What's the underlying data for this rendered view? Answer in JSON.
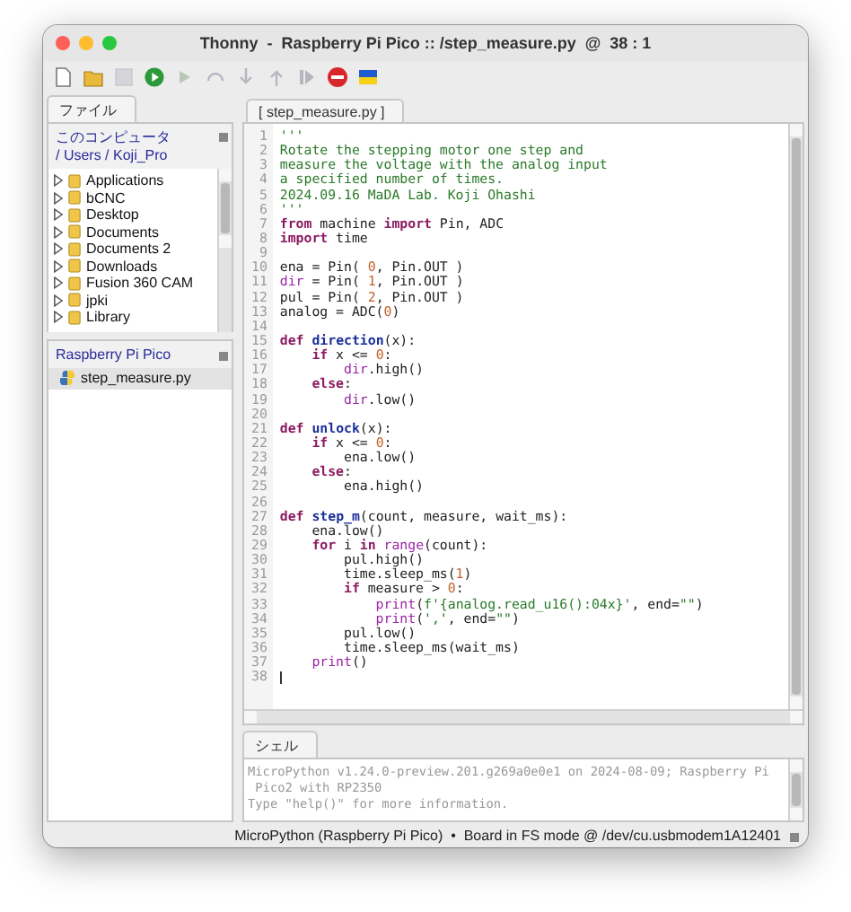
{
  "window": {
    "title": "Thonny  -  Raspberry Pi Pico :: /step_measure.py  @  38 : 1"
  },
  "toolbar": [
    {
      "kind": "new",
      "disabled": false
    },
    {
      "kind": "open",
      "disabled": false
    },
    {
      "kind": "save",
      "disabled": true
    },
    {
      "kind": "run",
      "disabled": false
    },
    {
      "kind": "debug",
      "disabled": true
    },
    {
      "kind": "step_over",
      "disabled": true
    },
    {
      "kind": "step_into",
      "disabled": true
    },
    {
      "kind": "step_out",
      "disabled": true
    },
    {
      "kind": "resume",
      "disabled": true
    },
    {
      "kind": "stop",
      "disabled": false
    },
    {
      "kind": "flag",
      "disabled": false
    }
  ],
  "files_panel": {
    "tab": "ファイル",
    "location": "このコンピュータ",
    "path": "/ Users / Koji_Pro",
    "items": [
      {
        "name": "Applications",
        "expanded": false
      },
      {
        "name": "bCNC",
        "expanded": false
      },
      {
        "name": "Desktop",
        "expanded": false
      },
      {
        "name": "Documents",
        "expanded": false
      },
      {
        "name": "Documents 2",
        "expanded": false
      },
      {
        "name": "Downloads",
        "expanded": false
      },
      {
        "name": "Fusion 360 CAM",
        "expanded": false
      },
      {
        "name": "jpki",
        "expanded": false
      },
      {
        "name": "Library",
        "expanded": false
      }
    ]
  },
  "device_panel": {
    "title": "Raspberry Pi Pico",
    "files": [
      {
        "name": "step_measure.py",
        "selected": true
      }
    ]
  },
  "editor": {
    "tab": "[ step_measure.py ]",
    "lines": [
      {
        "n": "1",
        "tokens": [
          {
            "kind": "comment",
            "text": "'''"
          }
        ]
      },
      {
        "n": "2",
        "tokens": [
          {
            "kind": "comment",
            "text": "Rotate the stepping motor one step and"
          }
        ]
      },
      {
        "n": "3",
        "tokens": [
          {
            "kind": "comment",
            "text": "measure the voltage with the analog input"
          }
        ]
      },
      {
        "n": "4",
        "tokens": [
          {
            "kind": "comment",
            "text": "a specified number of times."
          }
        ]
      },
      {
        "n": "5",
        "tokens": [
          {
            "kind": "comment",
            "text": "2024.09.16 MaDA Lab. Koji Ohashi"
          }
        ]
      },
      {
        "n": "6",
        "tokens": [
          {
            "kind": "comment",
            "text": "'''"
          }
        ]
      },
      {
        "n": "7",
        "tokens": [
          {
            "kind": "keyword",
            "text": "from"
          },
          {
            "kind": "plain",
            "text": " machine "
          },
          {
            "kind": "keyword",
            "text": "import"
          },
          {
            "kind": "plain",
            "text": " Pin, ADC"
          }
        ]
      },
      {
        "n": "8",
        "tokens": [
          {
            "kind": "keyword",
            "text": "import"
          },
          {
            "kind": "plain",
            "text": " time"
          }
        ]
      },
      {
        "n": "9"
      },
      {
        "n": "10",
        "tokens": [
          {
            "kind": "plain",
            "text": "ena = Pin( "
          },
          {
            "kind": "number",
            "text": "0"
          },
          {
            "kind": "plain",
            "text": ", Pin.OUT )"
          }
        ]
      },
      {
        "n": "11",
        "tokens": [
          {
            "kind": "builtin",
            "text": "dir"
          },
          {
            "kind": "plain",
            "text": " = Pin( "
          },
          {
            "kind": "number",
            "text": "1"
          },
          {
            "kind": "plain",
            "text": ", Pin.OUT )"
          }
        ]
      },
      {
        "n": "12",
        "tokens": [
          {
            "kind": "plain",
            "text": "pul = Pin( "
          },
          {
            "kind": "number",
            "text": "2"
          },
          {
            "kind": "plain",
            "text": ", Pin.OUT )"
          }
        ]
      },
      {
        "n": "13",
        "tokens": [
          {
            "kind": "plain",
            "text": "analog = ADC("
          },
          {
            "kind": "number",
            "text": "0"
          },
          {
            "kind": "plain",
            "text": ")"
          }
        ]
      },
      {
        "n": "14"
      },
      {
        "n": "15",
        "tokens": [
          {
            "kind": "keyword",
            "text": "def "
          },
          {
            "kind": "function",
            "text": "direction"
          },
          {
            "kind": "plain",
            "text": "(x):"
          }
        ]
      },
      {
        "n": "16",
        "tokens": [
          {
            "kind": "keyword",
            "text": "    if"
          },
          {
            "kind": "plain",
            "text": " x <= "
          },
          {
            "kind": "number",
            "text": "0"
          },
          {
            "kind": "plain",
            "text": ":"
          }
        ]
      },
      {
        "n": "17",
        "tokens": [
          {
            "kind": "builtin",
            "text": "        dir"
          },
          {
            "kind": "plain",
            "text": ".high()"
          }
        ]
      },
      {
        "n": "18",
        "tokens": [
          {
            "kind": "keyword",
            "text": "    else"
          },
          {
            "kind": "plain",
            "text": ":"
          }
        ]
      },
      {
        "n": "19",
        "tokens": [
          {
            "kind": "builtin",
            "text": "        dir"
          },
          {
            "kind": "plain",
            "text": ".low()"
          }
        ]
      },
      {
        "n": "20"
      },
      {
        "n": "21",
        "tokens": [
          {
            "kind": "keyword",
            "text": "def "
          },
          {
            "kind": "function",
            "text": "unlock"
          },
          {
            "kind": "plain",
            "text": "(x):"
          }
        ]
      },
      {
        "n": "22",
        "tokens": [
          {
            "kind": "keyword",
            "text": "    if"
          },
          {
            "kind": "plain",
            "text": " x <= "
          },
          {
            "kind": "number",
            "text": "0"
          },
          {
            "kind": "plain",
            "text": ":"
          }
        ]
      },
      {
        "n": "23",
        "tokens": [
          {
            "kind": "plain",
            "text": "        ena.low()"
          }
        ]
      },
      {
        "n": "24",
        "tokens": [
          {
            "kind": "keyword",
            "text": "    else"
          },
          {
            "kind": "plain",
            "text": ":"
          }
        ]
      },
      {
        "n": "25",
        "tokens": [
          {
            "kind": "plain",
            "text": "        ena.high()"
          }
        ]
      },
      {
        "n": "26"
      },
      {
        "n": "27",
        "tokens": [
          {
            "kind": "keyword",
            "text": "def "
          },
          {
            "kind": "function",
            "text": "step_m"
          },
          {
            "kind": "plain",
            "text": "(count, measure, wait_ms):"
          }
        ]
      },
      {
        "n": "28",
        "tokens": [
          {
            "kind": "plain",
            "text": "    ena.low()"
          }
        ]
      },
      {
        "n": "29",
        "tokens": [
          {
            "kind": "keyword",
            "text": "    for"
          },
          {
            "kind": "plain",
            "text": " i "
          },
          {
            "kind": "keyword",
            "text": "in"
          },
          {
            "kind": "builtin",
            "text": " range"
          },
          {
            "kind": "plain",
            "text": "(count):"
          }
        ]
      },
      {
        "n": "30",
        "tokens": [
          {
            "kind": "plain",
            "text": "        pul.high()"
          }
        ]
      },
      {
        "n": "31",
        "tokens": [
          {
            "kind": "plain",
            "text": "        time.sleep_ms("
          },
          {
            "kind": "number",
            "text": "1"
          },
          {
            "kind": "plain",
            "text": ")"
          }
        ]
      },
      {
        "n": "32",
        "tokens": [
          {
            "kind": "keyword",
            "text": "        if"
          },
          {
            "kind": "plain",
            "text": " measure > "
          },
          {
            "kind": "number",
            "text": "0"
          },
          {
            "kind": "plain",
            "text": ":"
          }
        ]
      },
      {
        "n": "33",
        "tokens": [
          {
            "kind": "builtin",
            "text": "            print"
          },
          {
            "kind": "plain",
            "text": "("
          },
          {
            "kind": "string",
            "text": "f'{analog.read_u16():04x}'"
          },
          {
            "kind": "plain",
            "text": ", end="
          },
          {
            "kind": "string",
            "text": "\"\""
          },
          {
            "kind": "plain",
            "text": ")"
          }
        ]
      },
      {
        "n": "34",
        "tokens": [
          {
            "kind": "builtin",
            "text": "            print"
          },
          {
            "kind": "plain",
            "text": "("
          },
          {
            "kind": "string",
            "text": "','"
          },
          {
            "kind": "plain",
            "text": ", end="
          },
          {
            "kind": "string",
            "text": "\"\""
          },
          {
            "kind": "plain",
            "text": ")"
          }
        ]
      },
      {
        "n": "35",
        "tokens": [
          {
            "kind": "plain",
            "text": "        pul.low()"
          }
        ]
      },
      {
        "n": "36",
        "tokens": [
          {
            "kind": "plain",
            "text": "        time.sleep_ms(wait_ms)"
          }
        ]
      },
      {
        "n": "37",
        "tokens": [
          {
            "kind": "builtin",
            "text": "    print"
          },
          {
            "kind": "plain",
            "text": "()"
          }
        ]
      },
      {
        "n": "38",
        "cursor": true
      }
    ]
  },
  "shell": {
    "tab": "シェル",
    "lines": [
      "MicroPython v1.24.0-preview.201.g269a0e0e1 on 2024-08-09; Raspberry Pi",
      " Pico2 with RP2350",
      "Type \"help()\" for more information."
    ]
  },
  "status_bar": {
    "text": "MicroPython (Raspberry Pi Pico)  •  Board in FS mode @ /dev/cu.usbmodem1A12401"
  }
}
